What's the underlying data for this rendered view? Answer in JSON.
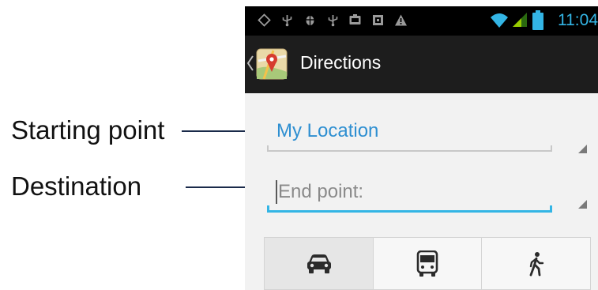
{
  "annotations": {
    "starting_point": "Starting point",
    "destination": "Destination"
  },
  "status_bar": {
    "time": "11:04",
    "left_icons": [
      "notification-icon",
      "usb-icon",
      "android-debug-icon",
      "usb-icon",
      "media-icon",
      "sim-icon",
      "warning-icon"
    ],
    "right_icons": [
      "wifi-icon",
      "signal-icon",
      "battery-icon"
    ],
    "accent_color": "#33b5e5"
  },
  "action_bar": {
    "title": "Directions",
    "icon": "maps-app-icon",
    "background": "#1d1d1d"
  },
  "directions_form": {
    "start": {
      "value": "My Location",
      "color": "#2e8fd1"
    },
    "end": {
      "value": "",
      "placeholder": "End point:"
    }
  },
  "travel_modes": [
    {
      "icon": "car-icon",
      "selected": true
    },
    {
      "icon": "bus-icon",
      "selected": false
    },
    {
      "icon": "walk-icon",
      "selected": false
    }
  ]
}
